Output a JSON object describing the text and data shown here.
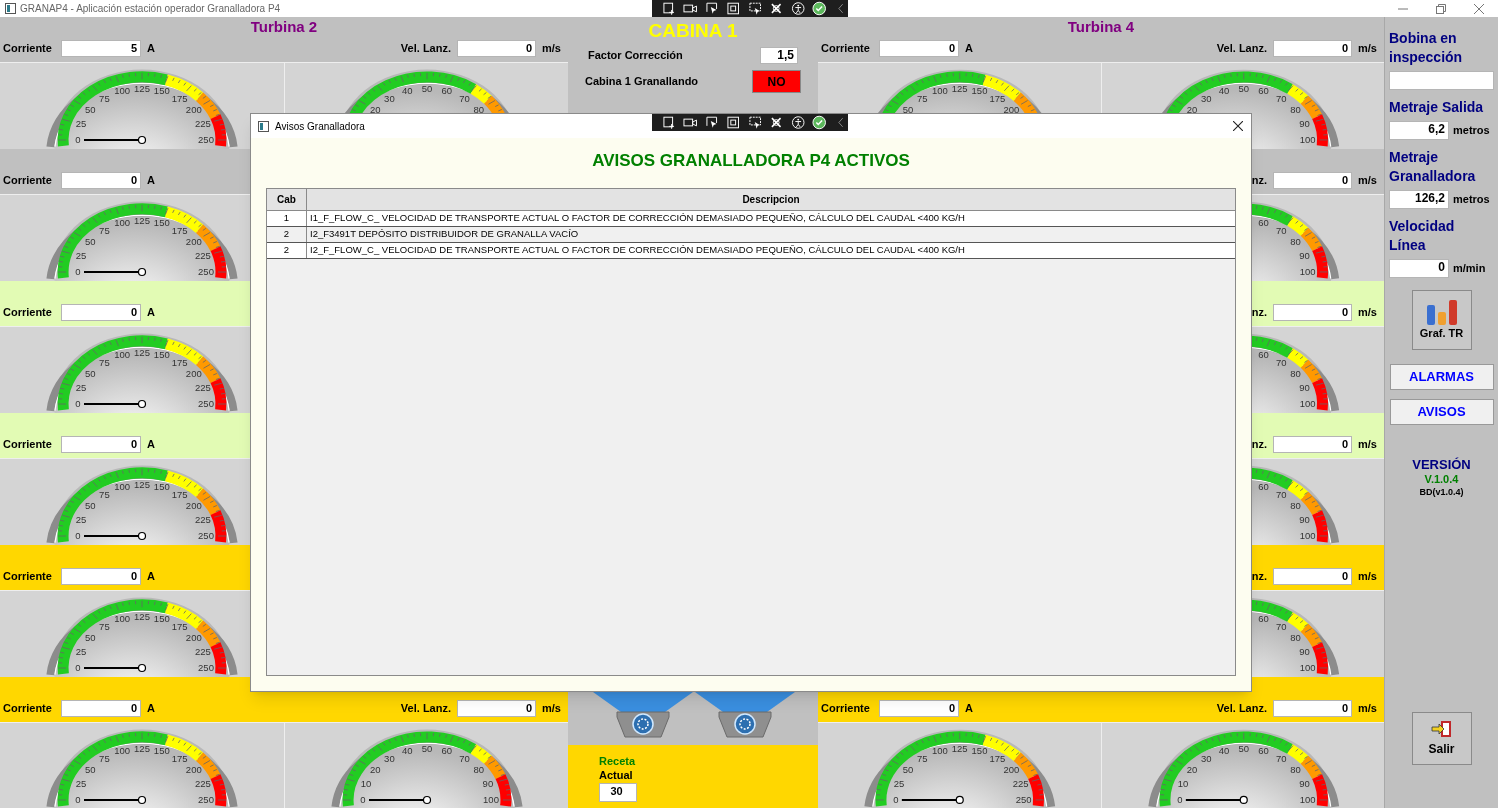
{
  "window": {
    "title": "GRANAP4 - Aplicación estación operador Granalladora P4"
  },
  "turbine_groups": [
    {
      "rows": [
        {
          "color": "#c0c0c0",
          "title": "Turbina 2",
          "current": {
            "label": "Corriente",
            "value": "5",
            "unit": "A"
          },
          "speed": {
            "label": "Vel. Lanz.",
            "value": "0",
            "unit": "m/s"
          },
          "left_gauge": {
            "kind": "current",
            "scale": [
              "0",
              "25",
              "50",
              "75",
              "100",
              "125",
              "150",
              "175",
              "200",
              "225",
              "250"
            ]
          },
          "right_gauge": {
            "kind": "speed",
            "scale": [
              "20",
              "30",
              "40",
              "50",
              "60",
              "70",
              "80"
            ]
          }
        },
        {
          "color": "#c0c0c0",
          "current": {
            "label": "Corriente",
            "value": "0",
            "unit": "A"
          },
          "left_gauge": {
            "kind": "current",
            "scale": [
              "0",
              "25",
              "50",
              "75",
              "100",
              "125",
              "150",
              "175",
              "200",
              "225",
              "250"
            ]
          }
        },
        {
          "color": "#e2fbb4",
          "current": {
            "label": "Corriente",
            "value": "0",
            "unit": "A"
          },
          "left_gauge": {
            "kind": "current",
            "scale": [
              "0",
              "25",
              "50",
              "75",
              "100",
              "125",
              "150",
              "175",
              "200",
              "225",
              "250"
            ]
          }
        },
        {
          "color": "#e2fbb4",
          "current": {
            "label": "Corriente",
            "value": "0",
            "unit": "A"
          },
          "left_gauge": {
            "kind": "current",
            "scale": [
              "0",
              "25",
              "50",
              "75",
              "100",
              "125",
              "150",
              "175",
              "200",
              "225",
              "250"
            ]
          }
        },
        {
          "color": "#ffd700",
          "current": {
            "label": "Corriente",
            "value": "0",
            "unit": "A"
          },
          "left_gauge": {
            "kind": "current",
            "scale": [
              "0",
              "25",
              "50",
              "75",
              "100",
              "125",
              "150",
              "175",
              "200",
              "225",
              "250"
            ]
          }
        },
        {
          "color": "#ffd700",
          "current": {
            "label": "Corriente",
            "value": "0",
            "unit": "A"
          },
          "speed": {
            "label": "Vel. Lanz.",
            "value": "0",
            "unit": "m/s"
          },
          "left_gauge": {
            "kind": "current",
            "scale": [
              "0",
              "25",
              "50",
              "75",
              "100",
              "125",
              "150",
              "175",
              "200",
              "225",
              "250"
            ]
          },
          "right_gauge": {
            "kind": "speed",
            "scale": [
              "0",
              "10",
              "20",
              "30",
              "40",
              "50",
              "60",
              "70",
              "80",
              "90",
              "100"
            ]
          }
        }
      ]
    },
    {
      "rows": [
        {
          "color": "#c0c0c0",
          "title": "Turbina 4",
          "current": {
            "label": "Corriente",
            "value": "0",
            "unit": "A"
          },
          "speed": {
            "label": "Vel. Lanz.",
            "value": "0",
            "unit": "m/s"
          },
          "left_gauge": {
            "kind": "current",
            "scale": [
              "50",
              "75",
              "100",
              "125",
              "150",
              "175",
              "200"
            ]
          },
          "right_gauge": {
            "kind": "speed",
            "scale": [
              "20",
              "30",
              "40",
              "50",
              "60",
              "70",
              "80",
              "90",
              "100"
            ]
          }
        },
        {
          "color": "#c0c0c0",
          "speed": {
            "label": "nz.",
            "value": "0",
            "unit": "m/s"
          },
          "right_gauge": {
            "kind": "speed",
            "scale": [
              "60",
              "70",
              "80",
              "90",
              "100"
            ]
          }
        },
        {
          "color": "#e2fbb4",
          "speed": {
            "label": "nz.",
            "value": "0",
            "unit": "m/s"
          },
          "right_gauge": {
            "kind": "speed",
            "scale": [
              "60",
              "70",
              "80",
              "90",
              "100"
            ]
          }
        },
        {
          "color": "#e2fbb4",
          "speed": {
            "label": "nz.",
            "value": "0",
            "unit": "m/s"
          },
          "right_gauge": {
            "kind": "speed",
            "scale": [
              "60",
              "70",
              "80",
              "90",
              "100"
            ]
          }
        },
        {
          "color": "#ffd700",
          "speed": {
            "label": "nz.",
            "value": "0",
            "unit": "m/s"
          },
          "right_gauge": {
            "kind": "speed",
            "scale": [
              "60",
              "70",
              "80",
              "90",
              "100"
            ]
          }
        },
        {
          "color": "#ffd700",
          "current": {
            "label": "Corriente",
            "value": "0",
            "unit": "A"
          },
          "speed": {
            "label": "Vel. Lanz.",
            "value": "0",
            "unit": "m/s"
          },
          "left_gauge": {
            "kind": "current",
            "scale": [
              "0",
              "25",
              "50",
              "75",
              "100",
              "125",
              "150",
              "175",
              "200",
              "225",
              "250"
            ]
          },
          "right_gauge": {
            "kind": "speed",
            "scale": [
              "0",
              "10",
              "20",
              "30",
              "40",
              "50",
              "60",
              "70",
              "80",
              "90",
              "100"
            ]
          }
        }
      ]
    }
  ],
  "cabin": {
    "title": "CABINA 1",
    "factor": {
      "label": "Factor Corrección",
      "value": "1,5"
    },
    "status": {
      "label": "Cabina 1 Granallando",
      "value": "NO",
      "on": false
    },
    "recipe": {
      "label": "Receta",
      "sublabel": "Actual",
      "value": "30"
    }
  },
  "side_panel": {
    "readings": [
      {
        "label": "Bobina en inspección"
      },
      {
        "label": "Metraje Salida",
        "value": "6,2",
        "unit": "metros"
      },
      {
        "label": "Metraje Granalladora",
        "value": "126,2",
        "unit": "metros"
      },
      {
        "label": "Velocidad Línea",
        "value": "0",
        "unit": "m/min"
      }
    ],
    "chart_button": "Graf. TR",
    "buttons": [
      "ALARMAS",
      "AVISOS"
    ],
    "version": {
      "title": "VERSIÓN",
      "number": "V.1.0.4",
      "db": "BD(v1.0.4)"
    },
    "exit_button": "Salir"
  },
  "dialog": {
    "title": "Avisos Granalladora",
    "heading": "AVISOS GRANALLADORA P4 ACTIVOS",
    "table": {
      "columns": [
        "Cab",
        "Descripcion"
      ],
      "rows": [
        [
          "1",
          "I1_F_FLOW_C_ VELOCIDAD DE TRANSPORTE ACTUAL O FACTOR DE CORRECCIÓN DEMASIADO PEQUEÑO, CÁLCULO DEL CAUDAL <400 KG/H"
        ],
        [
          "2",
          "I2_F3491T DEPÓSITO DISTRIBUIDOR DE GRANALLA VACÍO"
        ],
        [
          "2",
          "I2_F_FLOW_C_ VELOCIDAD DE TRANSPORTE ACTUAL O FACTOR DE CORRECCIÓN DEMASIADO PEQUEÑO, CÁLCULO DEL CAUDAL <400 KG/H"
        ]
      ]
    }
  }
}
